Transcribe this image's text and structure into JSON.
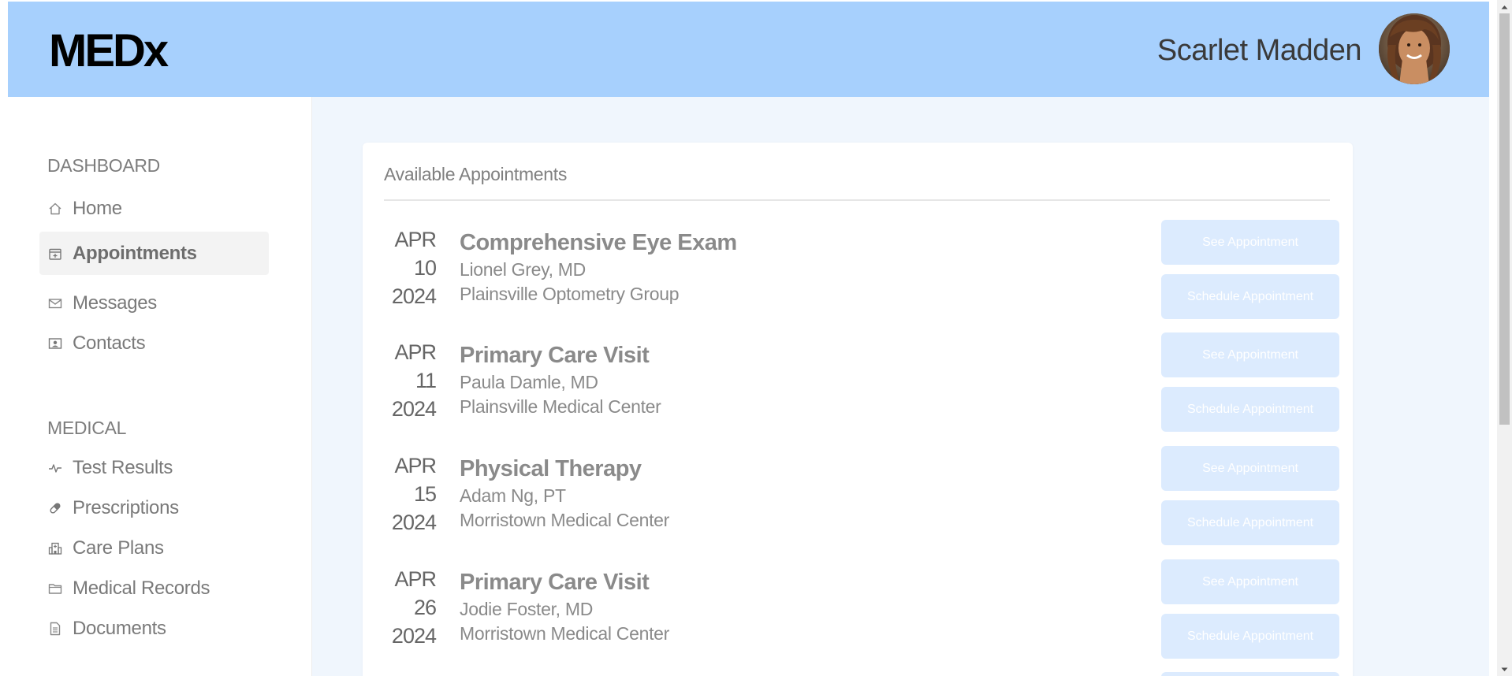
{
  "header": {
    "logo": "MEDx",
    "user_name": "Scarlet Madden",
    "colors": {
      "header_bg": "#a7d0fd"
    }
  },
  "sidebar": {
    "sections": [
      {
        "title": "DASHBOARD",
        "items": [
          {
            "label": "Home",
            "icon": "home-icon",
            "active": false
          },
          {
            "label": "Appointments",
            "icon": "calendar-plus-icon",
            "active": true
          },
          {
            "label": "Messages",
            "icon": "envelope-icon",
            "active": false
          },
          {
            "label": "Contacts",
            "icon": "contact-card-icon",
            "active": false
          }
        ]
      },
      {
        "title": "MEDICAL",
        "items": [
          {
            "label": "Test Results",
            "icon": "pulse-icon",
            "active": false
          },
          {
            "label": "Prescriptions",
            "icon": "capsule-icon",
            "active": false
          },
          {
            "label": "Care Plans",
            "icon": "hospital-icon",
            "active": false
          },
          {
            "label": "Medical Records",
            "icon": "folder-icon",
            "active": false
          },
          {
            "label": "Documents",
            "icon": "document-icon",
            "active": false
          }
        ]
      }
    ]
  },
  "main": {
    "card_title": "Available Appointments",
    "appointments": [
      {
        "month": "APR",
        "day": "10",
        "year": "2024",
        "title": "Comprehensive Eye Exam",
        "doctor": "Lionel Grey, MD",
        "location": "Plainsville Optometry Group",
        "see_label": "See Appointment",
        "schedule_label": "Schedule Appointment"
      },
      {
        "month": "APR",
        "day": "11",
        "year": "2024",
        "title": "Primary Care Visit",
        "doctor": "Paula Damle, MD",
        "location": "Plainsville Medical Center",
        "see_label": "See Appointment",
        "schedule_label": "Schedule Appointment"
      },
      {
        "month": "APR",
        "day": "15",
        "year": "2024",
        "title": "Physical Therapy",
        "doctor": "Adam Ng, PT",
        "location": "Morristown Medical Center",
        "see_label": "See Appointment",
        "schedule_label": "Schedule Appointment"
      },
      {
        "month": "APR",
        "day": "26",
        "year": "2024",
        "title": "Primary Care Visit",
        "doctor": "Jodie Foster, MD",
        "location": "Morristown Medical Center",
        "see_label": "See Appointment",
        "schedule_label": "Schedule Appointment"
      }
    ],
    "colors": {
      "button_bg": "#dcebfe",
      "main_bg": "#f0f6fd"
    }
  }
}
